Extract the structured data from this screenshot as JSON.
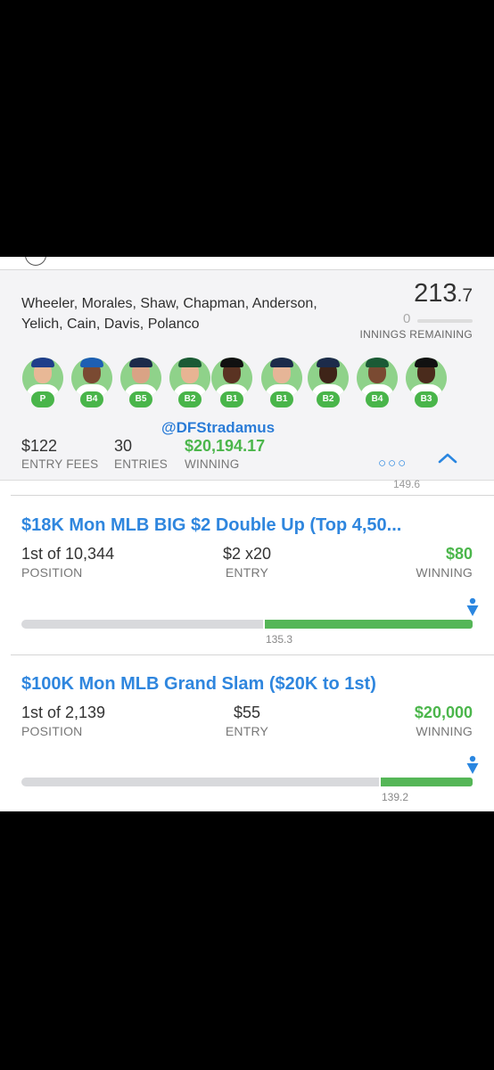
{
  "lineup": {
    "players_line1": "Wheeler, Morales, Shaw, Chapman, Anderson,",
    "players_line2": "Yelich, Cain, Davis, Polanco",
    "score_main": "213",
    "score_dec": ".7",
    "innings_remaining_value": "0",
    "innings_remaining_label": "INNINGS REMAINING",
    "positions": [
      "P",
      "B4",
      "B5",
      "B2",
      "B1",
      "B1",
      "B2",
      "B4",
      "B3"
    ],
    "watermark": "@DFStradamus",
    "entry_fees_value": "$122",
    "entry_fees_label": "ENTRY FEES",
    "entries_value": "30",
    "entries_label": "ENTRIES",
    "winning_value": "$20,194.17",
    "winning_label": "WINNING",
    "more_icon": "more-dots-icon",
    "collapse_icon": "chevron-up-icon",
    "previous_score": "149.6"
  },
  "contests": [
    {
      "title": "$18K Mon MLB BIG $2 Double Up (Top 4,50...",
      "position_value": "1st of 10,344",
      "position_label": "POSITION",
      "entry_value": "$2 x20",
      "entry_label": "ENTRY",
      "winning_value": "$80",
      "winning_label": "WINNING",
      "cash_line": "135.3",
      "progress_fraction": 1.0
    },
    {
      "title": "$100K Mon MLB Grand Slam ($20K to 1st)",
      "position_value": "1st of 2,139",
      "position_label": "POSITION",
      "entry_value": "$55",
      "entry_label": "ENTRY",
      "winning_value": "$20,000",
      "winning_label": "WINNING",
      "cash_line": "139.2",
      "progress_fraction": 1.0
    }
  ],
  "colors": {
    "link_blue": "#2f86de",
    "win_green": "#4bb64b",
    "avatar_bg": "#8fd28a"
  }
}
